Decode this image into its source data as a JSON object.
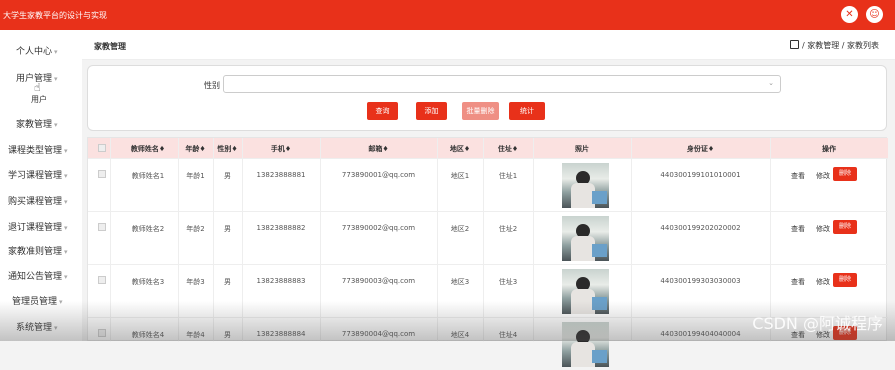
{
  "app": {
    "title": "大学生家教平台的设计与实现"
  },
  "topbar": {
    "icons": [
      "close-icon",
      "user-icon"
    ],
    "icon_glyphs": [
      "✕",
      "☺"
    ]
  },
  "sidebar": {
    "items": [
      {
        "label": "个人中心"
      },
      {
        "label": "用户管理"
      },
      {
        "label": "家教管理"
      },
      {
        "label": "课程类型管理"
      },
      {
        "label": "学习课程管理"
      },
      {
        "label": "购买课程管理"
      },
      {
        "label": "退订课程管理"
      },
      {
        "label": "家教准则管理"
      },
      {
        "label": "通知公告管理"
      },
      {
        "label": "管理员管理"
      },
      {
        "label": "系统管理"
      }
    ],
    "sub_item": "用户",
    "arrow": "▾"
  },
  "header": {
    "page_title": "家教管理",
    "breadcrumb": "/ 家教管理 / 家教列表"
  },
  "search": {
    "gender_label": "性别",
    "gender_value": "",
    "buttons": {
      "query": "查询",
      "add": "添加",
      "batch_delete": "批量删除",
      "stats": "统计"
    }
  },
  "table": {
    "columns": [
      "教师姓名",
      "年龄",
      "性别",
      "手机",
      "邮箱",
      "地区",
      "住址",
      "照片",
      "身份证",
      "操作"
    ],
    "sort_mark": "♦",
    "rows": [
      {
        "name": "教师姓名1",
        "age": "年龄1",
        "gender": "男",
        "phone": "13823888881",
        "email": "773890001@qq.com",
        "region": "地区1",
        "address": "住址1",
        "id_card": "440300199101010001"
      },
      {
        "name": "教师姓名2",
        "age": "年龄2",
        "gender": "男",
        "phone": "13823888882",
        "email": "773890002@qq.com",
        "region": "地区2",
        "address": "住址2",
        "id_card": "440300199202020002"
      },
      {
        "name": "教师姓名3",
        "age": "年龄3",
        "gender": "男",
        "phone": "13823888883",
        "email": "773890003@qq.com",
        "region": "地区3",
        "address": "住址3",
        "id_card": "440300199303030003"
      },
      {
        "name": "教师姓名4",
        "age": "年龄4",
        "gender": "男",
        "phone": "13823888884",
        "email": "773890004@qq.com",
        "region": "地区4",
        "address": "住址4",
        "id_card": "440300199404040004"
      }
    ],
    "actions": {
      "view": "查看",
      "edit": "修改",
      "delete": "删除"
    }
  },
  "watermark": "CSDN @阿诚程序",
  "colors": {
    "primary": "#e8311a",
    "batch_delete": "#ef8f84",
    "table_header": "#fbe1e0"
  }
}
